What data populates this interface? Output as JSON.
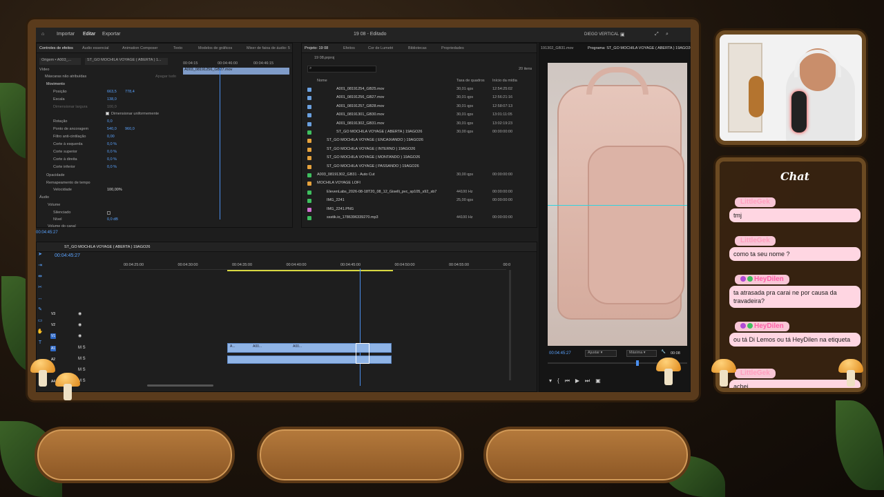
{
  "menu": {
    "import": "Importar",
    "edit": "Editar",
    "export": "Exportar",
    "title": "19 08 - Editado",
    "workspace": "DIEGO VERTICAL"
  },
  "effects_panel": {
    "tabs": [
      "Controles de efeitos",
      "Áudio essencial",
      "Animation Composer",
      "Texto",
      "Modelos de gráficos",
      "Mixer de faixa de áudio: 5"
    ],
    "source": "Origem • A003_...",
    "sequence": "ST_GO MOCHILA VOYAGE ( ABERTA ) 1...",
    "time_a": "00:04:15",
    "time_b": "00:04:46:00",
    "time_c": "00:04:46:15",
    "clip": "A003_08191256_GB27.mov",
    "video_label": "Vídeo",
    "masks": "Máscaras não atribuídas",
    "motion": "Movimento",
    "reset_all": "Apagar tudo",
    "props": [
      {
        "name": "Posição",
        "v1": "663,5",
        "v2": "778,4"
      },
      {
        "name": "Escala",
        "v1": "138,0",
        "v2": ""
      },
      {
        "name": "Dimensionar largura",
        "v1": "100,0",
        "v2": ""
      },
      {
        "name": "Dimensionar uniformemente",
        "v1": "",
        "v2": ""
      },
      {
        "name": "Rotação",
        "v1": "0,0",
        "v2": ""
      },
      {
        "name": "Ponto de ancoragem",
        "v1": "540,0",
        "v2": "960,0"
      },
      {
        "name": "Filtro anti-cintilação",
        "v1": "0,00",
        "v2": ""
      },
      {
        "name": "Corte à esquerda",
        "v1": "0,0 %",
        "v2": ""
      },
      {
        "name": "Corte superior",
        "v1": "0,0 %",
        "v2": ""
      },
      {
        "name": "Corte à direita",
        "v1": "0,0 %",
        "v2": ""
      },
      {
        "name": "Corte inferior",
        "v1": "0,0 %",
        "v2": ""
      }
    ],
    "opacity": "Opacidade",
    "time_remap": "Remapeamento de tempo",
    "speed": "Velocidade",
    "speed_val": "100,00%",
    "audio_label": "Áudio",
    "volume": "Volume",
    "mute": "Silenciado",
    "level": "Nível",
    "level_val": "0,0 dB",
    "channel_vol": "Volume do canal",
    "timecode": "00:04:45:27"
  },
  "project_panel": {
    "tabs": [
      "Projeto: 19 08",
      "Efeitos",
      "Cor de Lumetri",
      "Bibliotecas",
      "Propriedades"
    ],
    "file": "19 08.prproj",
    "count": "20 itens",
    "col_name": "Nome",
    "col_fps": "Taxa de quadros",
    "col_start": "Início da mídia",
    "rows": [
      {
        "name": "A001_08191254_GB25.mov",
        "fps": "30,01 qps",
        "start": "12:54:25:02",
        "color": "#6aa0e0",
        "indent": 2
      },
      {
        "name": "A001_08191256_GB27.mov",
        "fps": "30,01 qps",
        "start": "12:56:21:16",
        "color": "#6aa0e0",
        "indent": 2
      },
      {
        "name": "A001_08191257_GB28.mov",
        "fps": "30,01 qps",
        "start": "12:58:07:13",
        "color": "#6aa0e0",
        "indent": 2
      },
      {
        "name": "A001_08191301_GB30.mov",
        "fps": "30,01 qps",
        "start": "13:01:11:05",
        "color": "#6aa0e0",
        "indent": 2
      },
      {
        "name": "A001_08191302_GB31.mov",
        "fps": "30,01 qps",
        "start": "13:02:19:23",
        "color": "#6aa0e0",
        "indent": 2
      },
      {
        "name": "ST_GO MOCHILA VOYAGE ( ABERTA ) 19AGO26",
        "fps": "30,00 qps",
        "start": "00:00:00:00",
        "color": "#3fbf5f",
        "indent": 2
      },
      {
        "name": "ST_GO MOCHILA VOYAGE ( ENCAIXANDO ) 19AGO26",
        "fps": "",
        "start": "",
        "color": "#e6a23c",
        "indent": 1
      },
      {
        "name": "ST_GO MOCHILA VOYAGE ( INTERNO ) 19AGO26",
        "fps": "",
        "start": "",
        "color": "#e6a23c",
        "indent": 1
      },
      {
        "name": "ST_GO MOCHILA VOYAGE ( MONTANDO ) 19AGO26",
        "fps": "",
        "start": "",
        "color": "#e6a23c",
        "indent": 1
      },
      {
        "name": "ST_GO MOCHILA VOYAGE ( PASSANDO ) 19AGO26",
        "fps": "",
        "start": "",
        "color": "#e6a23c",
        "indent": 1
      },
      {
        "name": "A003_08191302_GB31 - Auto Cut",
        "fps": "30,00 qps",
        "start": "00:00:00:00",
        "color": "#3fbf5f",
        "indent": 0
      },
      {
        "name": "MOCHILA VOYAGE LOFI",
        "fps": "",
        "start": "",
        "color": "#e6a23c",
        "indent": 0
      },
      {
        "name": "ElevenLabs_2026-08-18T20_08_12_Giselli_pvc_sp105_s92_sb7",
        "fps": "44100 Hz",
        "start": "00:00:00:00",
        "color": "#3fbf5f",
        "indent": 1
      },
      {
        "name": "IMG_2241",
        "fps": "25,00 qps",
        "start": "00:00:00:00",
        "color": "#3fbf5f",
        "indent": 1
      },
      {
        "name": "IMG_2241.PNG",
        "fps": "",
        "start": "",
        "color": "#d06fd0",
        "indent": 1
      },
      {
        "name": "ssstik.io_1786396339270.mp3",
        "fps": "44100 Hz",
        "start": "00:00:00:00",
        "color": "#3fbf5f",
        "indent": 1
      }
    ]
  },
  "program_panel": {
    "source_name": "191302_GB31.mov",
    "title": "Programa: ST_GO MOCHILA VOYAGE ( ABERTA ) 19AGO26",
    "timecode": "00:04:45:27",
    "fit": "Ajustar",
    "quality": "Máxima",
    "duration": "00:08"
  },
  "timeline": {
    "sequence": "ST_GO MOCHILA VOYAGE ( ABERTA ) 19AGO26",
    "timecode": "00:04:45:27",
    "ruler": [
      "00:04:25:00",
      "00:04:30:00",
      "00:04:35:00",
      "00:04:40:00",
      "00:04:45:00",
      "00:04:50:00",
      "00:04:55:00",
      "00:0"
    ],
    "tracks": [
      "V3",
      "V2",
      "V1",
      "A1",
      "A2",
      "A3",
      "A4"
    ],
    "clip_labels": [
      "A...",
      "A00...",
      "A00..."
    ]
  },
  "chat": {
    "title": "Chat",
    "messages": [
      {
        "user": "LittleGek",
        "text": "tmj",
        "badges": false
      },
      {
        "user": "LittleGek",
        "text": "como ta seu nome ?",
        "badges": false
      },
      {
        "user": "HeyDilen",
        "text": "ta atrasada pra carai ne por causa da travadeira?",
        "badges": true
      },
      {
        "user": "HeyDilen",
        "text": "ou tá Di Lemos ou tá HeyDilen na etiqueta",
        "badges": true
      },
      {
        "user": "LittleGek",
        "text": "achei",
        "badges": false
      }
    ]
  },
  "colors": {
    "accent": "#5aa3ff",
    "wood": "#6b4a22",
    "chat_bubble": "#ffd6e2",
    "name_pink": "#ff9fbf",
    "name_magenta": "#ff5fa8"
  }
}
